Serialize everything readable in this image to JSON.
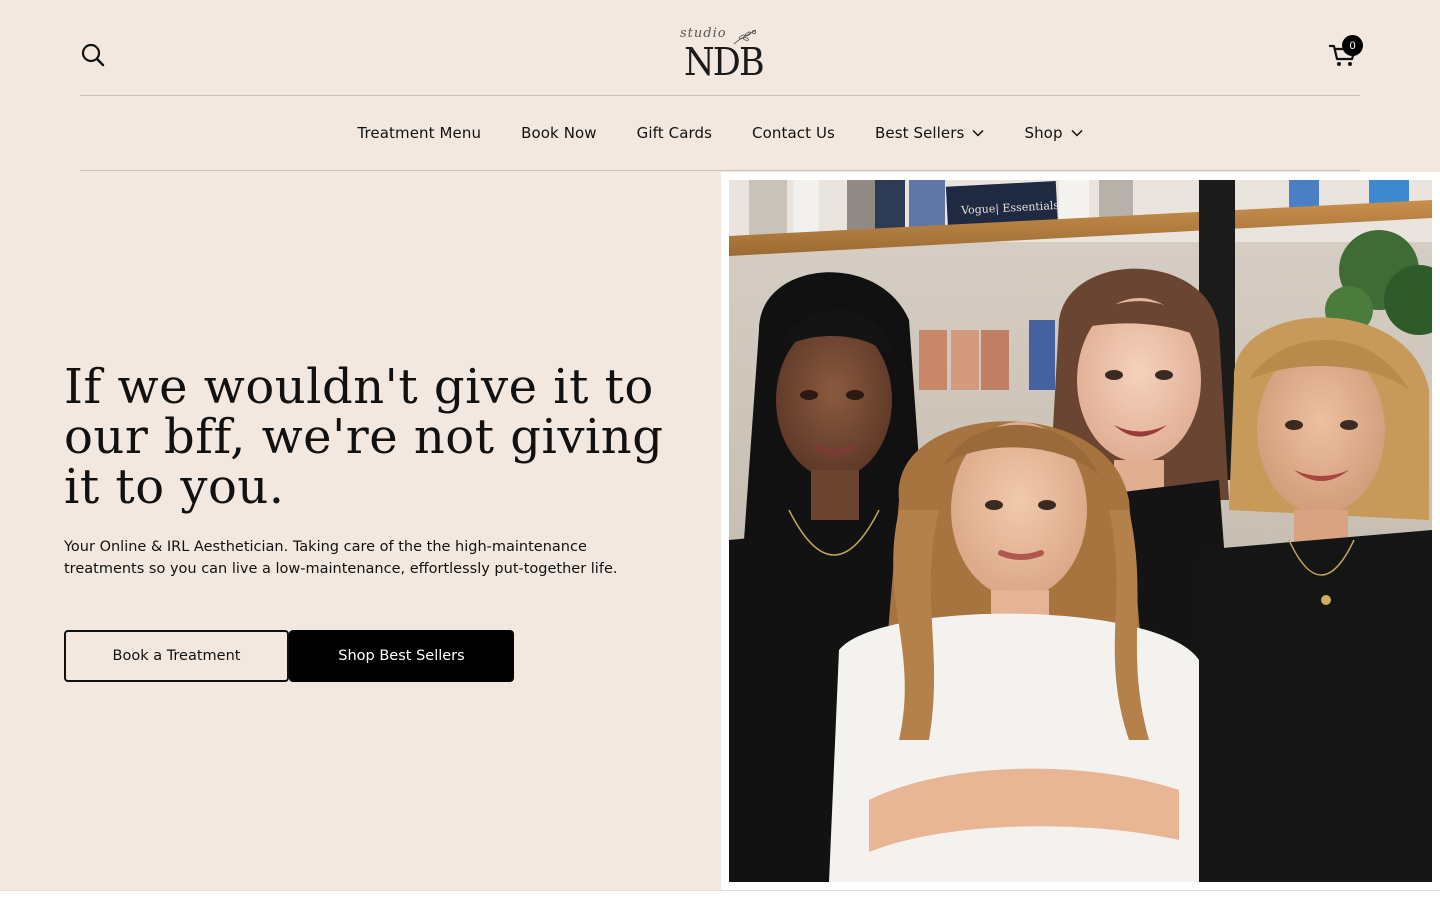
{
  "header": {
    "logo": {
      "script": "studio",
      "main": "NDB"
    },
    "cart_count": "0"
  },
  "nav": {
    "items": [
      {
        "label": "Treatment Menu",
        "dropdown": false
      },
      {
        "label": "Book Now",
        "dropdown": false
      },
      {
        "label": "Gift Cards",
        "dropdown": false
      },
      {
        "label": "Contact Us",
        "dropdown": false
      },
      {
        "label": "Best Sellers",
        "dropdown": true
      },
      {
        "label": "Shop",
        "dropdown": true
      }
    ]
  },
  "hero": {
    "title": "If we wouldn't give it to our bff, we're not giving it to you.",
    "subtitle": "Your Online & IRL Aesthetician. Taking care of the the high-maintenance treatments so you can live a low-maintenance, effortlessly put-together life.",
    "primary_button": "Book a Treatment",
    "secondary_button": "Shop Best Sellers",
    "image_alt": "Four smiling women in a studio in front of product shelves",
    "shelf_label": "Vogue| Essentials"
  },
  "colors": {
    "background": "#f3e8e0",
    "text": "#111111",
    "button_dark": "#000000",
    "divider": "#c9c0b9"
  }
}
